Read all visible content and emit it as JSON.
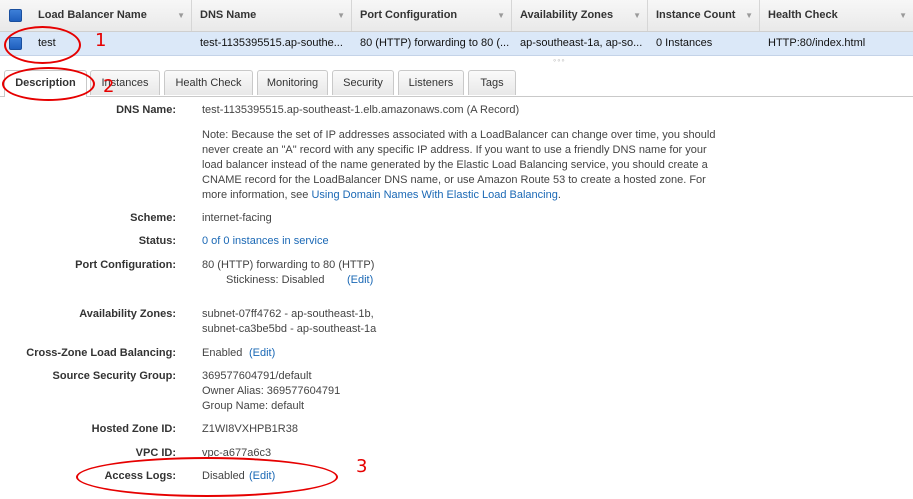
{
  "table": {
    "headers": [
      "Load Balancer Name",
      "DNS Name",
      "Port Configuration",
      "Availability Zones",
      "Instance Count",
      "Health Check"
    ],
    "row": {
      "name": "test",
      "dns": "test-1135395515.ap-southe...",
      "port": "80 (HTTP) forwarding to 80 (...",
      "zones": "ap-southeast-1a, ap-so...",
      "instances": "0 Instances",
      "health": "HTTP:80/index.html"
    }
  },
  "tabs": [
    "Description",
    "Instances",
    "Health Check",
    "Monitoring",
    "Security",
    "Listeners",
    "Tags"
  ],
  "details": {
    "dns_label": "DNS Name:",
    "dns_value": "test-1135395515.ap-southeast-1.elb.amazonaws.com (A Record)",
    "note_text": "Note: Because the set of IP addresses associated with a LoadBalancer can change over time, you should never create an \"A\" record with any specific IP address. If you want to use a friendly DNS name for your load balancer instead of the name generated by the Elastic Load Balancing service, you should create a CNAME record for the LoadBalancer DNS name, or use Amazon Route 53 to create a hosted zone. For more information, see",
    "note_link": "Using Domain Names With Elastic Load Balancing",
    "note_end": ".",
    "scheme_label": "Scheme:",
    "scheme_value": "internet-facing",
    "status_label": "Status:",
    "status_value": "0 of 0 instances in service",
    "port_label": "Port Configuration:",
    "port_value": "80 (HTTP) forwarding to 80 (HTTP)",
    "stickiness": "Stickiness: Disabled",
    "edit": "(Edit)",
    "az_label": "Availability Zones:",
    "az_1": "subnet-07ff4762 - ap-southeast-1b,",
    "az_2": "subnet-ca3be5bd - ap-southeast-1a",
    "crosszone_label": "Cross-Zone Load Balancing:",
    "crosszone_value": "Enabled",
    "ssg_label": "Source Security Group:",
    "ssg_1": "369577604791/default",
    "ssg_2": "Owner Alias: 369577604791",
    "ssg_3": "Group Name: default",
    "hz_label": "Hosted Zone ID:",
    "hz_value": "Z1WI8VXHPB1R38",
    "vpc_label": "VPC ID:",
    "vpc_value": "vpc-a677a6c3",
    "logs_label": "Access Logs:",
    "logs_value": "Disabled"
  },
  "annotations": [
    "1",
    "2",
    "3"
  ],
  "colors": {
    "annotation": "#e60000",
    "link": "#1a68b5",
    "selected_row": "#dbe8f8"
  }
}
